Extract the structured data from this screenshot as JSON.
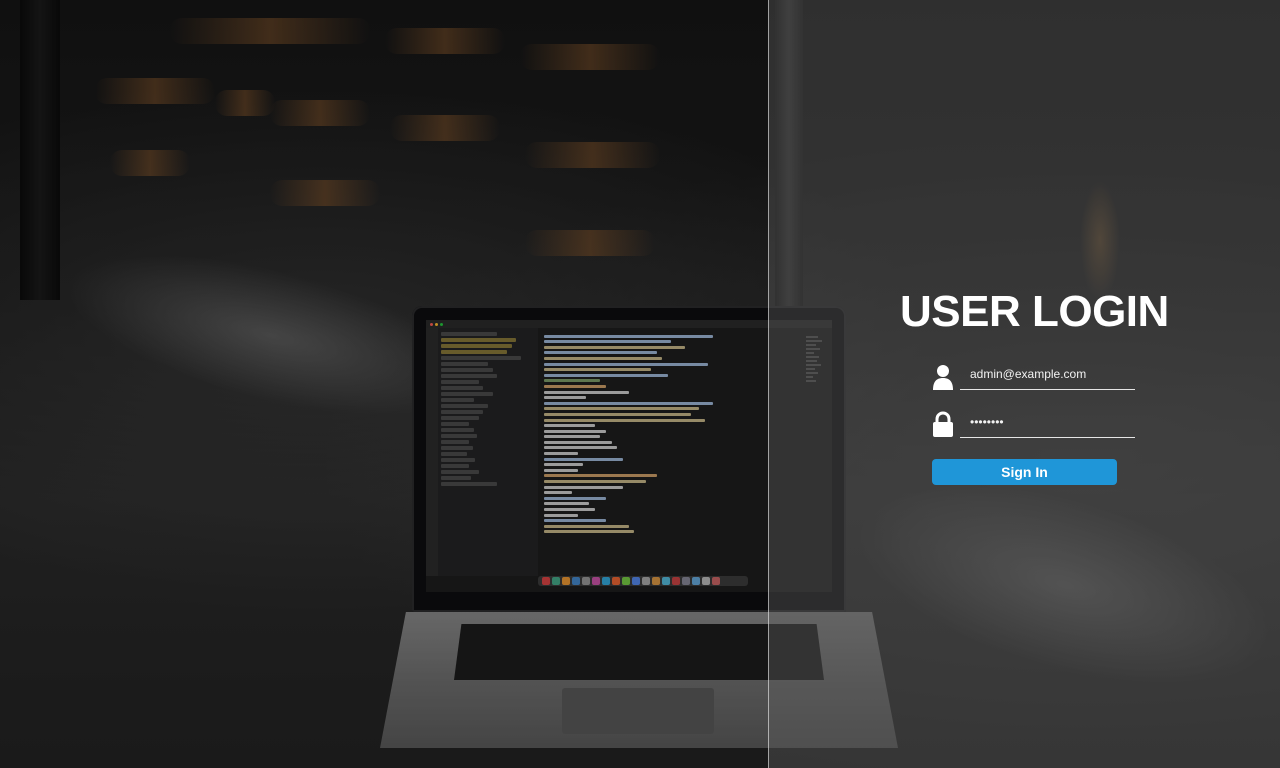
{
  "login": {
    "title": "USER LOGIN",
    "email": {
      "value": "admin@example.com",
      "icon": "user-icon"
    },
    "password": {
      "value": "••••••••",
      "icon": "lock-icon"
    },
    "submit_label": "Sign In"
  },
  "colors": {
    "accent": "#1f96d8",
    "title": "#ffffff",
    "panel_overlay": "rgba(70,70,70,0.55)"
  }
}
